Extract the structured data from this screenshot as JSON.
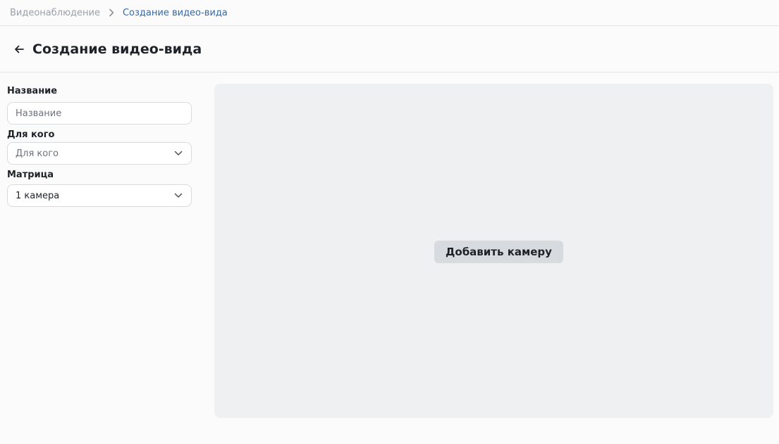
{
  "breadcrumb": {
    "root": "Видеонаблюдение",
    "current": "Создание видео-вида"
  },
  "header": {
    "title": "Создание видео-вида",
    "back_icon": "arrow-left-icon"
  },
  "form": {
    "name": {
      "label": "Название",
      "placeholder": "Название",
      "value": ""
    },
    "audience": {
      "label": "Для кого",
      "placeholder": "Для кого",
      "icon": "chevron-down-icon"
    },
    "matrix": {
      "label": "Матрица",
      "selected": "1 камера",
      "icon": "chevron-down-icon"
    }
  },
  "preview": {
    "add_camera_label": "Добавить камеру"
  },
  "colors": {
    "accent": "#2f6ab1",
    "preview_bg": "#eff0f2",
    "button_bg": "#d7dade"
  }
}
